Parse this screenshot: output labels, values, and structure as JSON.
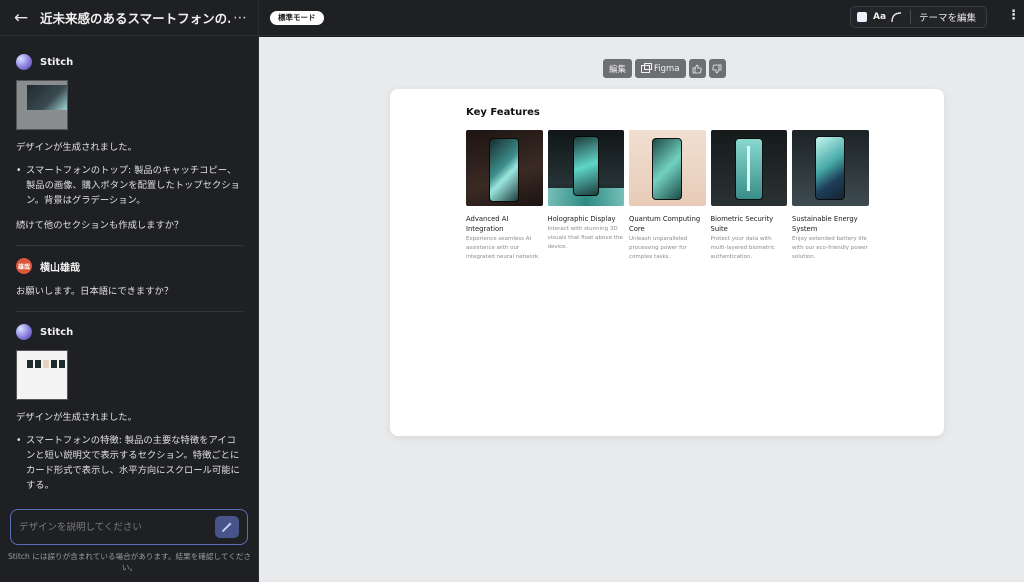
{
  "sidebar": {
    "title": "近未来感のあるスマートフォンの...",
    "messages": [
      {
        "sender": "Stitch",
        "text": "デザインが生成されました。",
        "bullet": "スマートフォンのトップ: 製品のキャッチコピー、製品の画像、購入ボタンを配置したトップセクション。背景はグラデーション。",
        "followup": "続けて他のセクションも作成しますか？"
      },
      {
        "sender": "横山雄哉",
        "avatar_text": "雄哉",
        "text": "お願いします。日本語にできますか？"
      },
      {
        "sender": "Stitch",
        "text": "デザインが生成されました。",
        "bullet": "スマートフォンの特徴: 製品の主要な特徴をアイコンと短い説明文で表示するセクション。特徴ごとにカード形式で表示し、水平方向にスクロール可能にする。"
      }
    ],
    "input_placeholder": "デザインを説明してください",
    "disclaimer": "Stitch には誤りが含まれている場合があります。結果を確認してください。"
  },
  "topbar": {
    "mode": "標準モード",
    "font_label": "Aa",
    "theme_edit": "テーマを編集"
  },
  "canvas": {
    "toolbar": {
      "edit": "編集",
      "figma": "Figma"
    },
    "section_title": "Key Features",
    "features": [
      {
        "name": "Advanced AI Integration",
        "desc": "Experience seamless AI assistance with our integrated neural network."
      },
      {
        "name": "Holographic Display",
        "desc": "Interact with stunning 3D visuals that float above the device."
      },
      {
        "name": "Quantum Computing Core",
        "desc": "Unleash unparalleled processing power for complex tasks."
      },
      {
        "name": "Biometric Security Suite",
        "desc": "Protect your data with multi-layered biometric authentication."
      },
      {
        "name": "Sustainable Energy System",
        "desc": "Enjoy extended battery life with our eco-friendly power solution."
      }
    ]
  },
  "colors": {
    "sidebar_bg": "#1f2023",
    "canvas_bg": "#e9eaec",
    "accent": "#5a6fb7"
  }
}
